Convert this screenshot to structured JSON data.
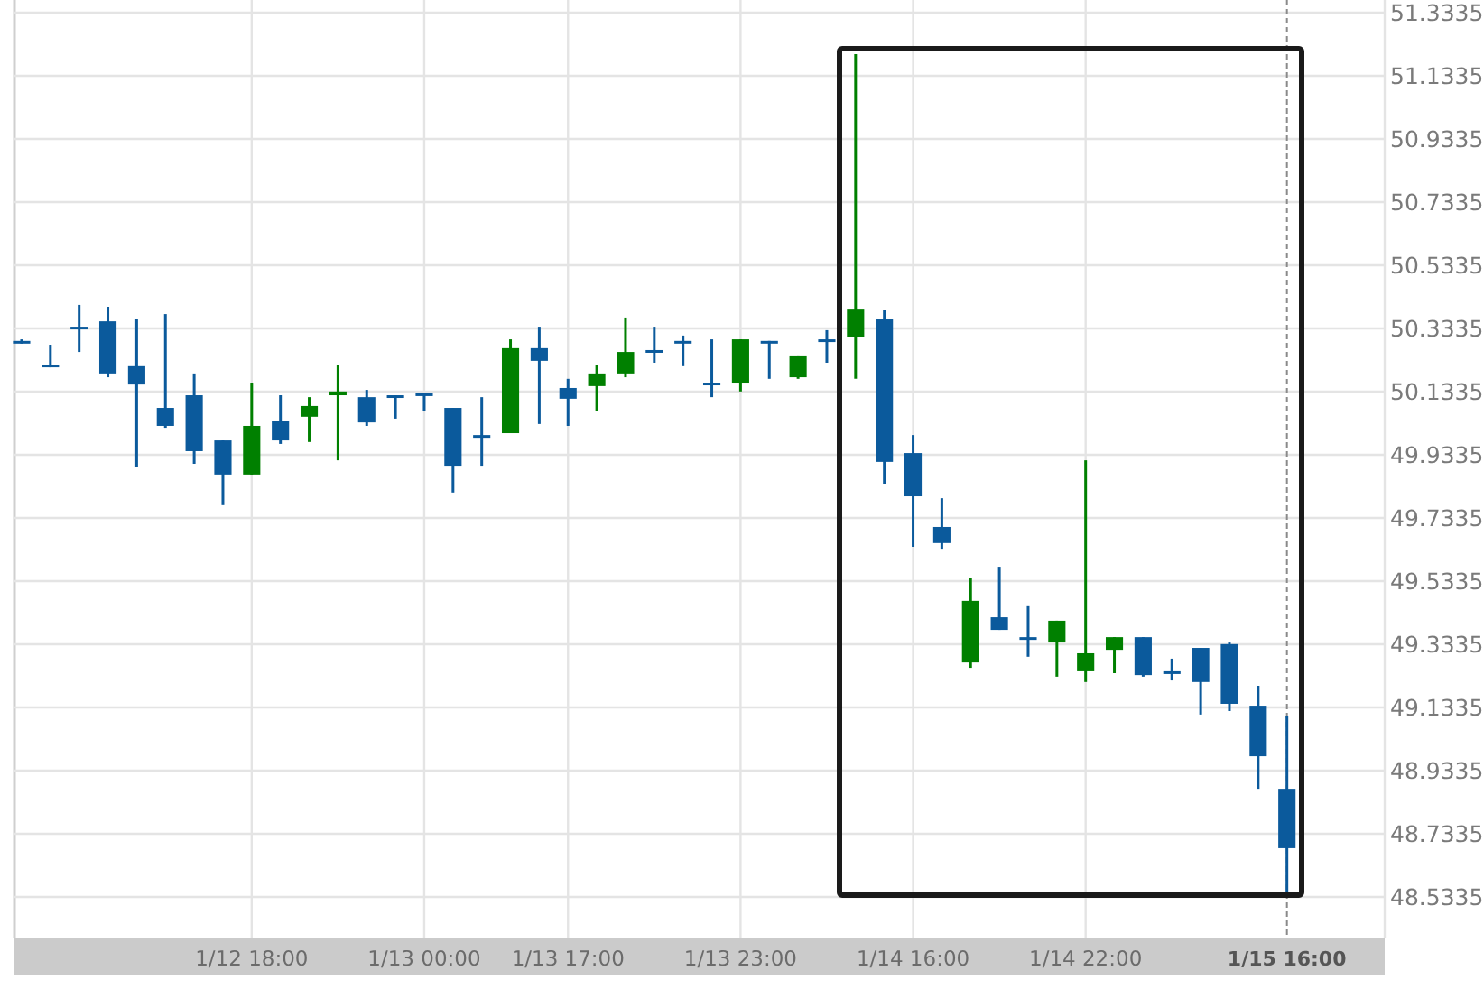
{
  "chart": {
    "chart_data": {
      "type": "candlestick",
      "grid": true,
      "ylim": [
        48.5335,
        51.3335
      ],
      "yticks": [
        51.3335,
        51.1335,
        50.9335,
        50.7335,
        50.5335,
        50.3335,
        50.1335,
        49.9335,
        49.7335,
        49.5335,
        49.3335,
        49.1335,
        48.9335,
        48.7335,
        48.5335
      ],
      "categories": [
        null,
        null,
        null,
        null,
        null,
        null,
        null,
        null,
        "1/12 18:00",
        null,
        null,
        null,
        null,
        null,
        "1/13 00:00",
        null,
        null,
        null,
        null,
        "1/13 17:00",
        null,
        null,
        null,
        null,
        null,
        "1/13 23:00",
        null,
        null,
        null,
        null,
        null,
        "1/14 16:00",
        null,
        null,
        null,
        null,
        null,
        "1/14 22:00",
        null,
        null,
        null,
        null,
        null,
        null,
        null
      ],
      "ohlc": [
        [
          50.294,
          50.299,
          50.288,
          50.294
        ],
        [
          50.219,
          50.282,
          50.219,
          50.219
        ],
        [
          50.339,
          50.408,
          50.259,
          50.334
        ],
        [
          50.356,
          50.402,
          50.179,
          50.191
        ],
        [
          50.214,
          50.362,
          49.894,
          50.156
        ],
        [
          50.082,
          50.379,
          50.019,
          50.025
        ],
        [
          50.122,
          50.191,
          49.905,
          49.945
        ],
        [
          49.979,
          49.979,
          49.774,
          49.871
        ],
        [
          49.871,
          50.162,
          49.871,
          50.025
        ],
        [
          50.042,
          50.122,
          49.968,
          49.979
        ],
        [
          50.054,
          50.116,
          49.974,
          50.088
        ],
        [
          50.122,
          50.219,
          49.916,
          50.134
        ],
        [
          50.116,
          50.139,
          50.025,
          50.036
        ],
        [
          50.122,
          50.122,
          50.048,
          50.122
        ],
        [
          50.128,
          50.128,
          50.071,
          50.128
        ],
        [
          50.082,
          50.082,
          49.814,
          49.899
        ],
        [
          49.996,
          50.116,
          49.899,
          49.996
        ],
        [
          50.002,
          50.299,
          50.002,
          50.271
        ],
        [
          50.271,
          50.339,
          50.031,
          50.231
        ],
        [
          50.145,
          50.174,
          50.025,
          50.111
        ],
        [
          50.151,
          50.219,
          50.071,
          50.191
        ],
        [
          50.191,
          50.368,
          50.179,
          50.259
        ],
        [
          50.265,
          50.339,
          50.225,
          50.265
        ],
        [
          50.294,
          50.311,
          50.214,
          50.294
        ],
        [
          50.162,
          50.299,
          50.116,
          50.162
        ],
        [
          50.162,
          50.299,
          50.134,
          50.299
        ],
        [
          50.294,
          50.294,
          50.174,
          50.294
        ],
        [
          50.179,
          50.248,
          50.174,
          50.248
        ],
        [
          50.299,
          50.328,
          50.225,
          50.299
        ],
        [
          50.305,
          51.202,
          50.174,
          50.396
        ],
        [
          50.362,
          50.391,
          49.842,
          49.911
        ],
        [
          49.939,
          49.996,
          49.642,
          49.802
        ],
        [
          49.705,
          49.796,
          49.636,
          49.654
        ],
        [
          49.276,
          49.545,
          49.259,
          49.471
        ],
        [
          49.419,
          49.579,
          49.379,
          49.379
        ],
        [
          49.356,
          49.454,
          49.294,
          49.356
        ],
        [
          49.339,
          49.408,
          49.231,
          49.408
        ],
        [
          49.248,
          49.916,
          49.214,
          49.305
        ],
        [
          49.316,
          49.356,
          49.242,
          49.356
        ],
        [
          49.356,
          49.356,
          49.231,
          49.236
        ],
        [
          49.248,
          49.288,
          49.219,
          49.248
        ],
        [
          49.322,
          49.322,
          49.111,
          49.214
        ],
        [
          49.334,
          49.339,
          49.122,
          49.145
        ],
        [
          49.139,
          49.202,
          48.876,
          48.979
        ],
        [
          48.876,
          49.105,
          48.545,
          48.688
        ]
      ]
    },
    "current_time": {
      "label": "1/15 16:00"
    }
  }
}
